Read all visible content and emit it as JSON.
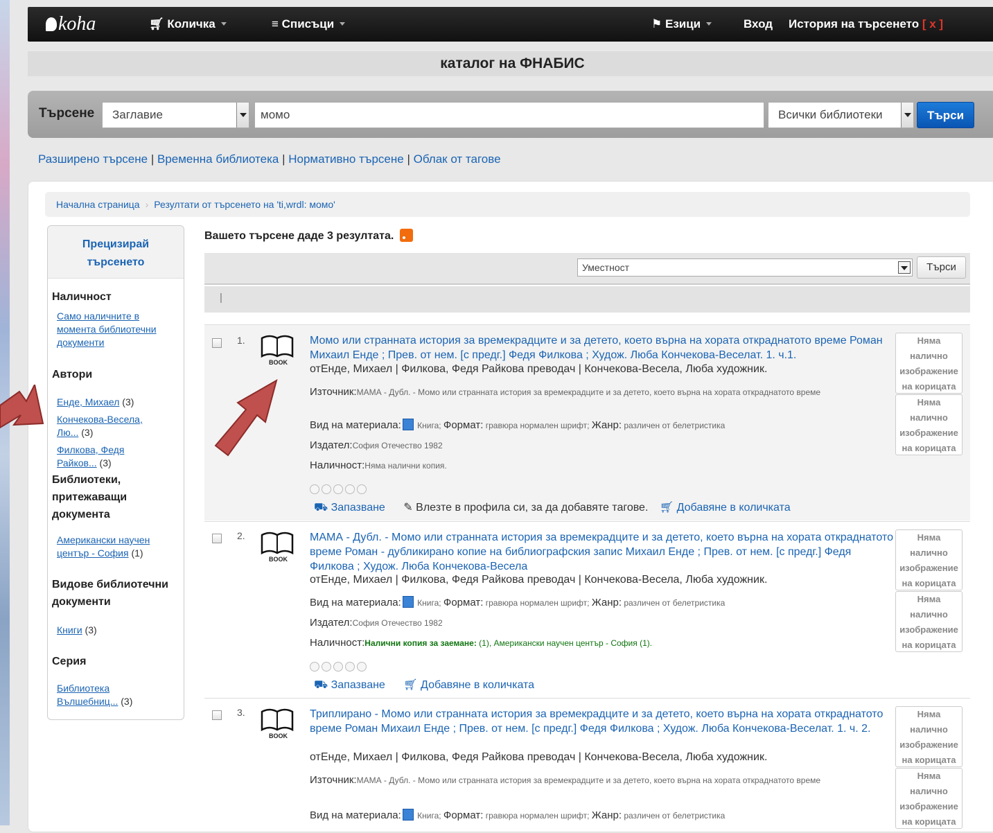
{
  "nav": {
    "logo": "koha",
    "cart": "Количка",
    "lists": "Списъци",
    "languages": "Езици",
    "login": "Вход",
    "history": "История на търсенето",
    "history_clear": "x"
  },
  "catalog_title": "каталог на ФНАБИС",
  "search": {
    "label": "Търсене",
    "type_selected": "Заглавие",
    "query": "момо",
    "library_selected": "Всички библиотеки",
    "button": "Търси"
  },
  "links": {
    "advanced": "Разширено търсене",
    "temp_library": "Временна библиотека",
    "authority": "Нормативно търсене",
    "tag_cloud": "Облак от тагове"
  },
  "breadcrumb": {
    "home": "Начална страница",
    "current": "Резултати от търсенето на 'ti,wrdl: момо'"
  },
  "facets": {
    "heading_line1": "Прецизирай",
    "heading_line2": "търсенето",
    "availability_title": "Наличност",
    "availability_link": "Само наличните в момента библиотечни документи",
    "authors_title": "Автори",
    "authors": [
      {
        "name": "Енде, Михаел",
        "count": "(3)"
      },
      {
        "name": "Кончекова-Весела, Лю...",
        "count": "(3)"
      },
      {
        "name": "Филкова, Федя Райков...",
        "count": "(3)"
      }
    ],
    "holding_title": "Библиотеки, притежаващи документа",
    "holding": {
      "name": "Американски научен център - София",
      "count": "(1)"
    },
    "itemtypes_title": "Видове библиотечни документи",
    "itemtypes": {
      "name": "Книги",
      "count": "(3)"
    },
    "series_title": "Серия",
    "series": {
      "name": "Библиотека Вълшебниц...",
      "count": "(3)"
    }
  },
  "results_summary": "Вашето търсене даде 3 резултата.",
  "sort": {
    "selected": "Уместност",
    "button": "Търси"
  },
  "labels": {
    "source": "Източник:",
    "material_type": "Вид на материала:",
    "book": "Книга",
    "format_label": "Формат:",
    "format_value": "гравюра нормален шрифт",
    "genre_label": "Жанр:",
    "genre_value": "различен от белетристика",
    "publisher": "Издател:",
    "availability": "Наличност:",
    "reserve": "Запазване",
    "login_tags": "Влезте в профила си, за да добавяте тагове.",
    "add_cart": "Добавяне в количката",
    "book_word": "BOOK",
    "no_cover_1": "Няма",
    "no_cover_2": "налично",
    "no_cover_3": "изображение",
    "no_cover_4": "на корицата"
  },
  "results": [
    {
      "number": "1.",
      "title": "Момо или странната история за времекрадците и за детето, което върна на хората откраднатото време Роман Михаил Енде ; Прев. от нем. [с предг.] Федя Филкова ; Худож. Люба Кончекова-Веселат. 1. ч.1.",
      "authors": "отЕнде, Михаел | Филкова, Федя Райкова преводач | Кончекова-Весела, Люба художник.",
      "source": "МАМА - Дубл. - Момо или странната история за времекрадците и за детето, което върна на хората откраднатото време",
      "publisher": "София Отечество 1982",
      "availability": "Няма налични копия."
    },
    {
      "number": "2.",
      "title": "МАМА - Дубл. - Момо или странната история за времекрадците и за детето, което върна на хората откраднатото време Роман - дубликирано копие на библиографския запис Михаил Енде ; Прев. от нем. [с предг.] Федя Филкова ; Худож. Люба Кончекова-Весела",
      "authors": "отЕнде, Михаел | Филкова, Федя Райкова преводач | Кончекова-Весела, Люба художник.",
      "publisher": "София Отечество 1982",
      "availability_bold": "Налични копия за заемане:",
      "availability_rest": "(1), Американски научен център - София (1)."
    },
    {
      "number": "3.",
      "title": "Триплирано - Момо или странната история за времекрадците и за детето, което върна на хората откраднатото време Роман Михаил Енде ; Прев. от нем. [с предг.] Федя Филкова ; Худож. Люба Кончекова-Веселат. 1. ч. 2.",
      "authors": "отЕнде, Михаел | Филкова, Федя Райкова преводач | Кончекова-Весела, Люба художник.",
      "source": "МАМА - Дубл. - Момо или странната история за времекрадците и за детето, което върна на хората откраднатото време"
    }
  ],
  "colors": {
    "link": "#1b64b3",
    "navbar": "#111111",
    "button": "#0a55b3",
    "annotation_arrow": "#c0504d",
    "available_text": "#107510"
  }
}
